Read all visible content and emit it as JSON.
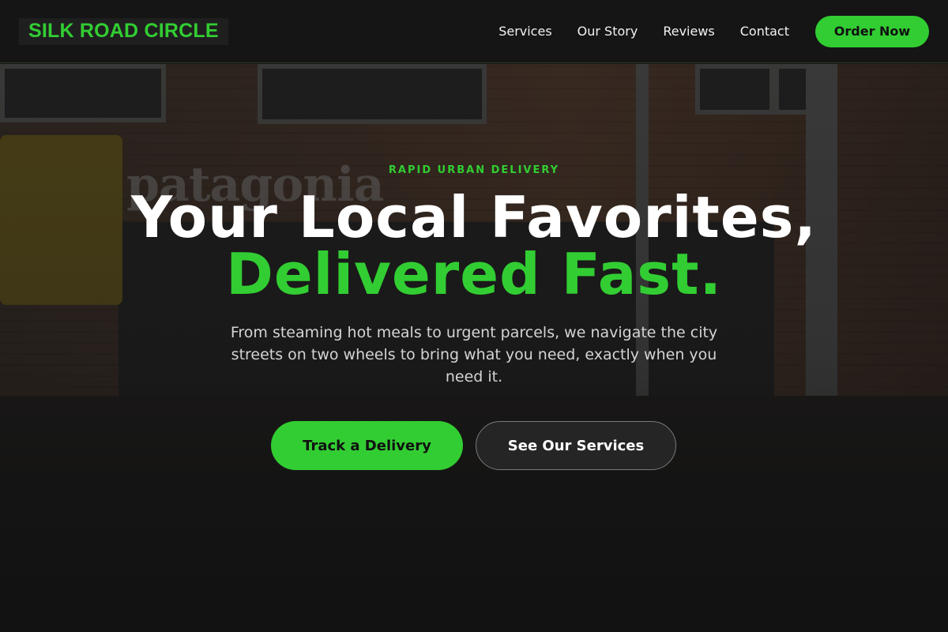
{
  "brand": {
    "name": "SILK ROAD CIRCLE",
    "accent_color": "#32cd32"
  },
  "nav": {
    "links": [
      "Services",
      "Our Story",
      "Reviews",
      "Contact"
    ],
    "cta_label": "Order Now"
  },
  "hero": {
    "background_image": "city street with brick building, storefront sign and traffic signal",
    "eyebrow": "RAPID URBAN DELIVERY",
    "headline_line1": "Your Local Favorites,",
    "headline_line2": "Delivered Fast.",
    "subtext": "From steaming hot meals to urgent parcels, we navigate the city streets on two wheels to bring what you need, exactly when you need it.",
    "primary_button": "Track a Delivery",
    "secondary_button": "See Our Services",
    "storefront_sign": "patagonia"
  }
}
